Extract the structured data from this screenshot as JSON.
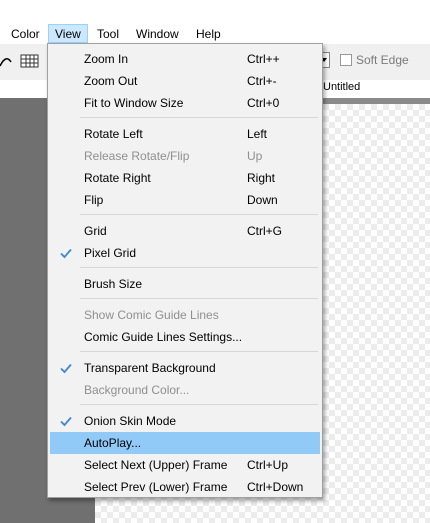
{
  "menubar": {
    "items": [
      "Color",
      "View",
      "Tool",
      "Window",
      "Help"
    ],
    "active": "View"
  },
  "toolbar": {
    "soft_edge_label": "Soft Edge",
    "soft_edge_checked": false
  },
  "document": {
    "tab_title": "Untitled"
  },
  "view_menu": {
    "items": [
      {
        "label": "Zoom In",
        "shortcut": "Ctrl++",
        "enabled": true,
        "checked": false
      },
      {
        "label": "Zoom Out",
        "shortcut": "Ctrl+-",
        "enabled": true,
        "checked": false
      },
      {
        "label": "Fit to Window Size",
        "shortcut": "Ctrl+0",
        "enabled": true,
        "checked": false
      },
      {
        "label": "Rotate Left",
        "shortcut": "Left",
        "enabled": true,
        "checked": false
      },
      {
        "label": "Release Rotate/Flip",
        "shortcut": "Up",
        "enabled": false,
        "checked": false
      },
      {
        "label": "Rotate Right",
        "shortcut": "Right",
        "enabled": true,
        "checked": false
      },
      {
        "label": "Flip",
        "shortcut": "Down",
        "enabled": true,
        "checked": false
      },
      {
        "label": "Grid",
        "shortcut": "Ctrl+G",
        "enabled": true,
        "checked": false
      },
      {
        "label": "Pixel Grid",
        "shortcut": "",
        "enabled": true,
        "checked": true
      },
      {
        "label": "Brush Size",
        "shortcut": "",
        "enabled": true,
        "checked": false
      },
      {
        "label": "Show Comic Guide Lines",
        "shortcut": "",
        "enabled": false,
        "checked": false
      },
      {
        "label": "Comic Guide Lines Settings...",
        "shortcut": "",
        "enabled": true,
        "checked": false
      },
      {
        "label": "Transparent Background",
        "shortcut": "",
        "enabled": true,
        "checked": true
      },
      {
        "label": "Background Color...",
        "shortcut": "",
        "enabled": false,
        "checked": false
      },
      {
        "label": "Onion Skin Mode",
        "shortcut": "",
        "enabled": true,
        "checked": true
      },
      {
        "label": "AutoPlay...",
        "shortcut": "",
        "enabled": true,
        "checked": false,
        "highlighted": true
      },
      {
        "label": "Select Next (Upper) Frame",
        "shortcut": "Ctrl+Up",
        "enabled": true,
        "checked": false
      },
      {
        "label": "Select Prev (Lower) Frame",
        "shortcut": "Ctrl+Down",
        "enabled": true,
        "checked": false
      }
    ]
  },
  "colors": {
    "highlight": "#91c9f7",
    "menu_active": "#cce8ff",
    "check": "#3c88d6"
  }
}
